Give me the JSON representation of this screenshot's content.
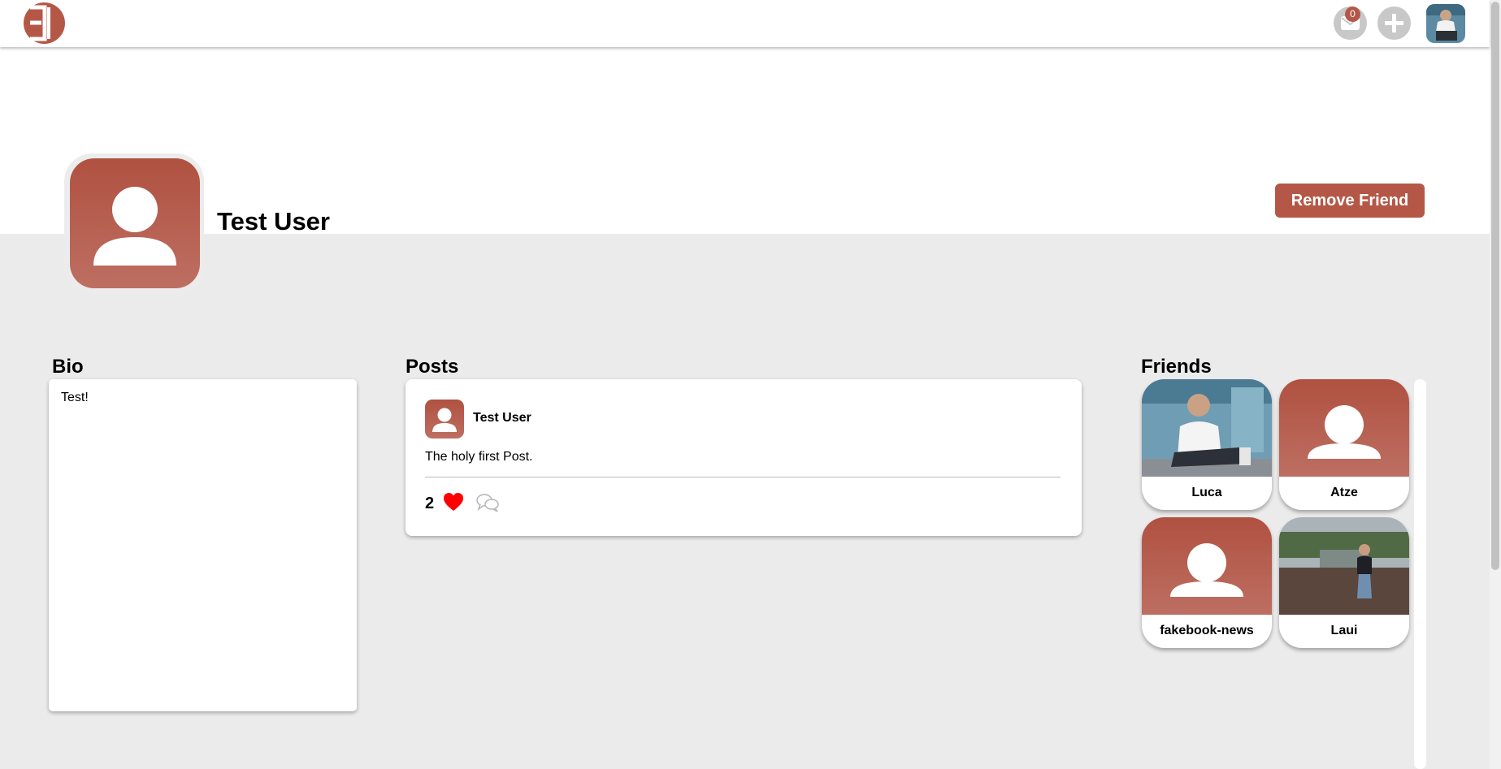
{
  "nav": {
    "logo_icon": "site-logo",
    "mail_icon": "envelope-icon",
    "mail_badge": "0",
    "add_icon": "plus-icon",
    "user_avatar": "user-photo-avatar"
  },
  "profile": {
    "name": "Test User",
    "avatar_icon": "default-user-avatar",
    "action_button": "Remove Friend"
  },
  "bio": {
    "title": "Bio",
    "text": "Test!"
  },
  "posts": {
    "title": "Posts",
    "items": [
      {
        "author": "Test User",
        "text": "The holy first Post.",
        "likes": "2",
        "like_icon": "heart-icon",
        "comment_icon": "comment-bubbles-icon"
      }
    ]
  },
  "friends": {
    "title": "Friends",
    "items": [
      {
        "name": "Luca",
        "image": "photo"
      },
      {
        "name": "Atze",
        "image": "default-avatar"
      },
      {
        "name": "fakebook-news",
        "image": "default-avatar"
      },
      {
        "name": "Laui",
        "image": "photo"
      }
    ]
  },
  "colors": {
    "accent": "#b55747",
    "background": "#ebebeb",
    "like": "#ff0000"
  }
}
